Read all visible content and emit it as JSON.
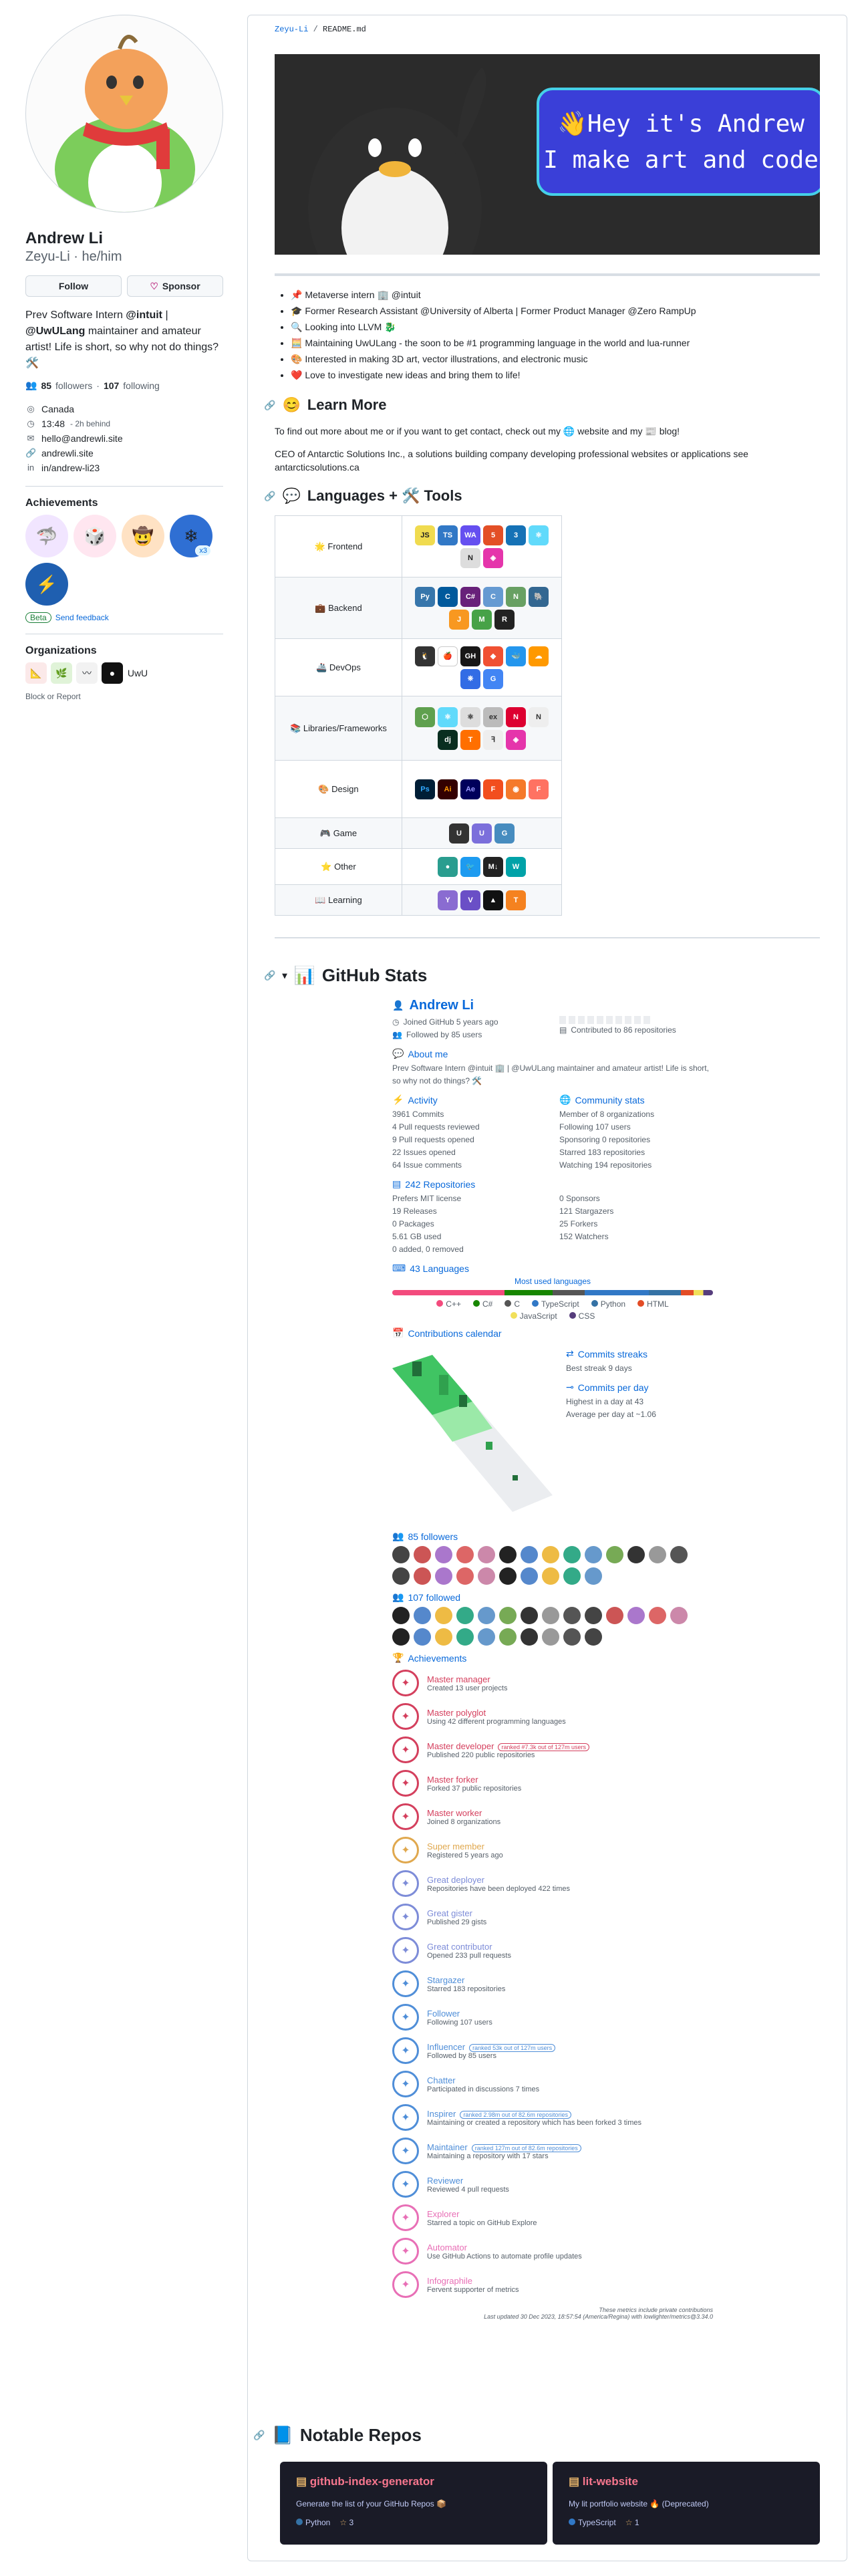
{
  "profile": {
    "name": "Andrew Li",
    "login": "Zeyu-Li",
    "pronouns": "he/him",
    "follow": "Follow",
    "sponsor": "Sponsor",
    "bio_1": "Prev Software Intern ",
    "bio_intuit": "@intuit",
    "bio_2": " | ",
    "bio_uwu": "@UwULang",
    "bio_3": " maintainer and amateur artist! Life is short, so why not do things?",
    "followers_count": "85",
    "followers_label": "followers",
    "following_count": "107",
    "following_label": "following",
    "location": "Canada",
    "time": "13:48",
    "time_note": "- 2h behind",
    "email": "hello@andrewli.site",
    "website": "andrewli.site",
    "linkedin": "in/andrew-li23",
    "achievements_title": "Achievements",
    "achievement_multiplier": "x3",
    "beta": "Beta",
    "feedback": "Send feedback",
    "orgs_title": "Organizations",
    "block": "Block or Report"
  },
  "readme": {
    "breadcrumb_user": "Zeyu-Li",
    "breadcrumb_sep": " / ",
    "breadcrumb_file": "README.md",
    "banner_line1": "👋Hey it's Andrew",
    "banner_line2": "I make art and code",
    "bullets": [
      "📌 Metaverse intern 🏢 @intuit",
      "🎓 Former Research Assistant @University of Alberta | Former Product Manager @Zero RampUp",
      "🔍 Looking into LLVM 🐉",
      "🧮 Maintaining UwULang - the soon to be #1 programming language in the world and lua-runner",
      "🎨 Interested in making 3D art, vector illustrations, and electronic music",
      "❤️ Love to investigate new ideas and bring them to life!"
    ],
    "learn_more": "Learn More",
    "learn_p1": "To find out more about me or if you want to get contact, check out my 🌐 website and my 📰 blog!",
    "learn_p2": "CEO of Antarctic Solutions Inc., a solutions building company developing professional websites or applications see antarcticsolutions.ca",
    "langs_title": "Languages + 🛠️ Tools",
    "categories": [
      "🌟 Frontend",
      "💼 Backend",
      "🚢 DevOps",
      "📚 Libraries/Frameworks",
      "🎨 Design",
      "🎮 Game",
      "⭐ Other",
      "📖 Learning"
    ],
    "stats_title": "GitHub Stats",
    "repos_title": "Notable Repos"
  },
  "stats": {
    "name": "Andrew Li",
    "joined": "Joined GitHub 5 years ago",
    "followed": "Followed by 85 users",
    "contributed": "Contributed to 86 repositories",
    "about_title": "About me",
    "about": "Prev Software Intern @intuit 🏢 | @UwULang maintainer and amateur artist! Life is short, so why not do things? 🛠️",
    "activity_title": "Activity",
    "community_title": "Community stats",
    "activity": [
      "3961 Commits",
      "4 Pull requests reviewed",
      "9 Pull requests opened",
      "22 Issues opened",
      "64 Issue comments"
    ],
    "community": [
      "Member of 8 organizations",
      "Following 107 users",
      "Sponsoring 0 repositories",
      "Starred 183 repositories",
      "Watching 194 repositories"
    ],
    "repos_title": "242 Repositories",
    "repos_left": [
      "Prefers MIT license",
      "19 Releases",
      "0 Packages",
      "5.61 GB used",
      "0 added, 0 removed"
    ],
    "repos_right": [
      "0 Sponsors",
      "121 Stargazers",
      "25 Forkers",
      "152 Watchers"
    ],
    "langs_title": "43 Languages",
    "most_used": "Most used languages",
    "langs": [
      "C++",
      "C#",
      "C",
      "TypeScript",
      "Python",
      "HTML",
      "JavaScript",
      "CSS"
    ],
    "cal_title": "Contributions calendar",
    "streak_title": "Commits streaks",
    "streak": "Best streak 9 days",
    "perday_title": "Commits per day",
    "perday_1": "Highest in a day at 43",
    "perday_2": "Average per day at ~1.06",
    "followers_title": "85 followers",
    "following_title": "107 followed",
    "ach_title": "Achievements",
    "achievements": [
      {
        "t": "Master manager",
        "d": "Created 13 user projects",
        "c": "#d43f5d"
      },
      {
        "t": "Master polyglot",
        "d": "Using 42 different programming languages",
        "c": "#d43f5d"
      },
      {
        "t": "Master developer",
        "d": "Published 220 public repositories",
        "c": "#d43f5d",
        "rank": "ranked #7.3k out of 127m users"
      },
      {
        "t": "Master forker",
        "d": "Forked 37 public repositories",
        "c": "#d43f5d"
      },
      {
        "t": "Master worker",
        "d": "Joined 8 organizations",
        "c": "#d43f5d"
      },
      {
        "t": "Super member",
        "d": "Registered 5 years ago",
        "c": "#e0a84e"
      },
      {
        "t": "Great deployer",
        "d": "Repositories have been deployed 422 times",
        "c": "#7d8cd8"
      },
      {
        "t": "Great gister",
        "d": "Published 29 gists",
        "c": "#7d8cd8"
      },
      {
        "t": "Great contributor",
        "d": "Opened 233 pull requests",
        "c": "#7d8cd8"
      },
      {
        "t": "Stargazer",
        "d": "Starred 183 repositories",
        "c": "#4f8ed8"
      },
      {
        "t": "Follower",
        "d": "Following 107 users",
        "c": "#4f8ed8"
      },
      {
        "t": "Influencer",
        "d": "Followed by 85 users",
        "c": "#4f8ed8",
        "rank": "ranked 53k out of 127m users"
      },
      {
        "t": "Chatter",
        "d": "Participated in discussions 7 times",
        "c": "#4f8ed8"
      },
      {
        "t": "Inspirer",
        "d": "Maintaining or created a repository which has been forked 3 times",
        "c": "#4f8ed8",
        "rank": "ranked 2.98m out of 82.6m repositories"
      },
      {
        "t": "Maintainer",
        "d": "Maintaining a repository with 17 stars",
        "c": "#4f8ed8",
        "rank": "ranked 127m out of 82.6m repositories"
      },
      {
        "t": "Reviewer",
        "d": "Reviewed 4 pull requests",
        "c": "#4f8ed8"
      },
      {
        "t": "Explorer",
        "d": "Starred a topic on GitHub Explore",
        "c": "#e86fb6"
      },
      {
        "t": "Automator",
        "d": "Use GitHub Actions to automate profile updates",
        "c": "#e86fb6"
      },
      {
        "t": "Infographile",
        "d": "Fervent supporter of metrics",
        "c": "#e86fb6"
      }
    ],
    "footer1": "These metrics include private contributions",
    "footer2": "Last updated 30 Dec 2023, 18:57:54 (America/Regina) with lowlighter/metrics@3.34.0"
  },
  "repos": [
    {
      "name": "github-index-generator",
      "desc": "Generate the list of your GitHub Repos 📦",
      "lang": "Python",
      "stars": "3",
      "color": "#3572A5"
    },
    {
      "name": "lit-website",
      "desc": "My lit portfolio website 🔥 (Deprecated)",
      "lang": "TypeScript",
      "stars": "1",
      "color": "#3178c6"
    }
  ]
}
